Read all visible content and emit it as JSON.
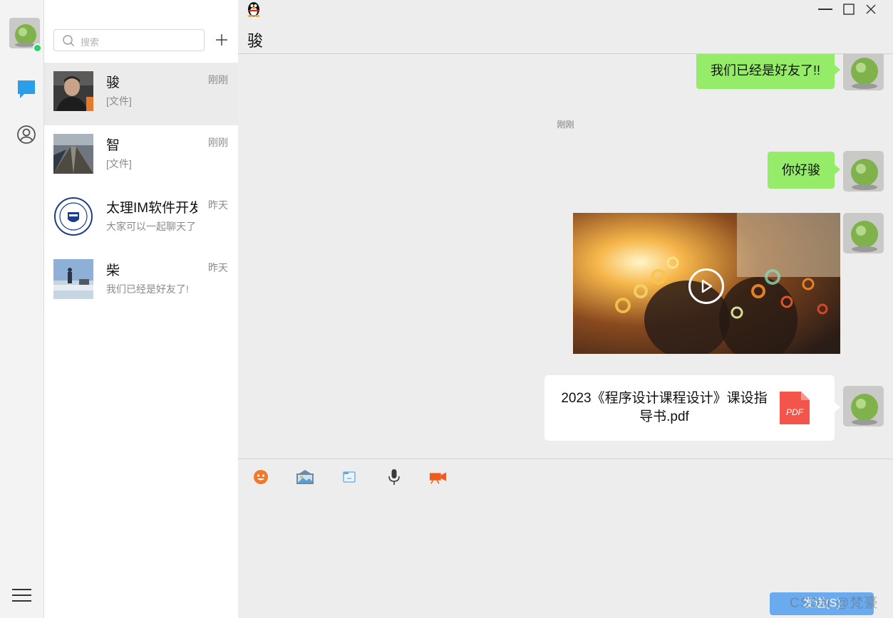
{
  "search": {
    "placeholder": "搜索"
  },
  "conversations": [
    {
      "name": "骏",
      "preview": "[文件]",
      "time": "刚刚",
      "active": true
    },
    {
      "name": "智",
      "preview": "[文件]",
      "time": "刚刚",
      "active": false
    },
    {
      "name": "太理IM软件开发",
      "preview": "大家可以一起聊天了",
      "time": "昨天",
      "active": false
    },
    {
      "name": "柴",
      "preview": "我们已经是好友了!",
      "time": "昨天",
      "active": false
    }
  ],
  "chat": {
    "title": "骏",
    "messages": [
      {
        "type": "text",
        "text": "我们已经是好友了!!"
      },
      {
        "type": "time",
        "text": "刚刚"
      },
      {
        "type": "text",
        "text": "你好骏"
      },
      {
        "type": "video"
      },
      {
        "type": "file",
        "file_name": "2023《程序设计课程设计》课设指导书.pdf",
        "file_badge": "PDF"
      }
    ],
    "send_label": "发送(S)",
    "watermark": "CSDN @梵豪"
  },
  "icons": {
    "rail": [
      "chat-bubble-icon",
      "contacts-icon",
      "menu-icon"
    ],
    "toolbar": [
      "emoji-icon",
      "image-icon",
      "folder-icon",
      "microphone-icon",
      "video-camera-icon"
    ],
    "window": [
      "minimize-icon",
      "maximize-icon",
      "close-icon"
    ]
  },
  "colors": {
    "accent": "#2b9ee9",
    "bubble": "#95ec69",
    "online": "#2bd06b",
    "pdf": "#f4554a",
    "send": "#6aabf0"
  }
}
